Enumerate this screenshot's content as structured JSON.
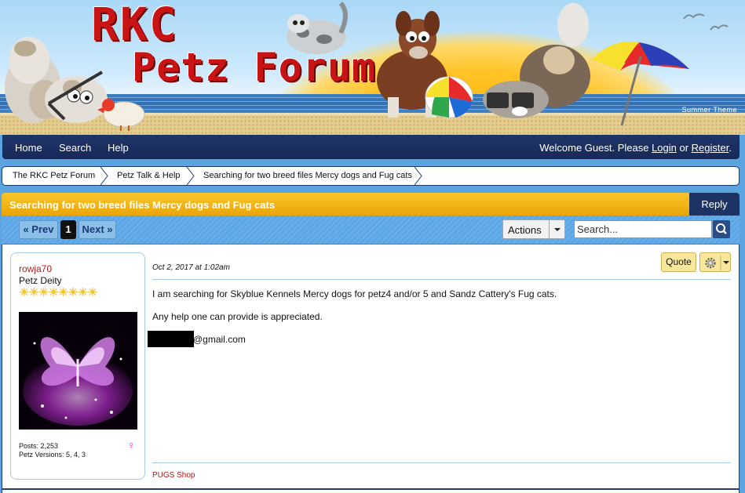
{
  "header": {
    "logo_line1": "RKC",
    "logo_line2": "Petz Forum",
    "theme_label": "Summer Theme"
  },
  "nav": {
    "items": [
      "Home",
      "Search",
      "Help"
    ],
    "welcome_prefix": "Welcome Guest. Please ",
    "login": "Login",
    "or": " or ",
    "register": "Register",
    "suffix": "."
  },
  "breadcrumb": [
    "The RKC Petz Forum",
    "Petz Talk & Help",
    "Searching for two breed files Mercy dogs and Fug cats"
  ],
  "thread": {
    "title": "Searching for two breed files Mercy dogs and Fug cats",
    "reply_label": "Reply"
  },
  "pagination": {
    "prev": "« Prev",
    "current": "1",
    "next": "Next »",
    "actions_label": "Actions",
    "search_placeholder": "Search..."
  },
  "post": {
    "author": "rowja70",
    "user_title": "Petz Deity",
    "stars": "☀☀☀☀☀☀☀☀",
    "posts": "Posts: 2,253",
    "versions": "Petz Versions: 5, 4, 3",
    "date": "Oct 2, 2017 at 1:02am",
    "quote_label": "Quote",
    "body": [
      "I am searching for Skyblue Kennels Mercy dogs for petz4 and/or 5 and Sandz Cattery's Fug cats.",
      "Any help one can provide is appreciated.",
      "@gmail.com"
    ],
    "signature_link": "PUGS Shop"
  },
  "colors": {
    "nav_bg": "#1e3566",
    "thread_header": "#f2b417",
    "username": "#b01818",
    "accent_blue": "#5aa6e6"
  }
}
